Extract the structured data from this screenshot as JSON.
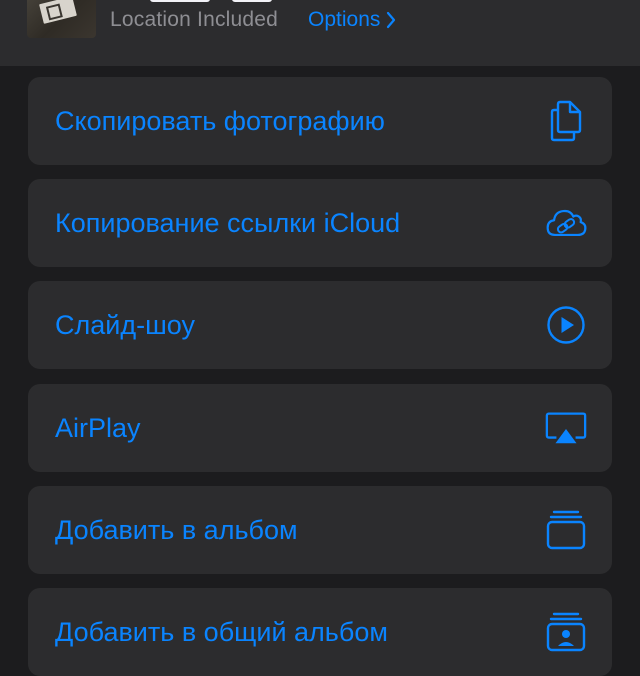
{
  "header": {
    "subtitle": "Location Included",
    "options_label": "Options"
  },
  "actions": [
    {
      "label": "Скопировать фотографию",
      "icon": "copy-icon"
    },
    {
      "label": "Копирование ссылки iCloud",
      "icon": "icloud-link-icon"
    },
    {
      "label": "Слайд-шоу",
      "icon": "play-circle-icon"
    },
    {
      "label": "AirPlay",
      "icon": "airplay-icon"
    },
    {
      "label": "Добавить в альбом",
      "icon": "album-stack-icon"
    },
    {
      "label": "Добавить в общий альбом",
      "icon": "shared-album-icon"
    }
  ],
  "colors": {
    "background": "#1c1c1e",
    "cell": "#2c2c2e",
    "accent": "#0a84ff",
    "secondary_text": "#8e8e93"
  }
}
